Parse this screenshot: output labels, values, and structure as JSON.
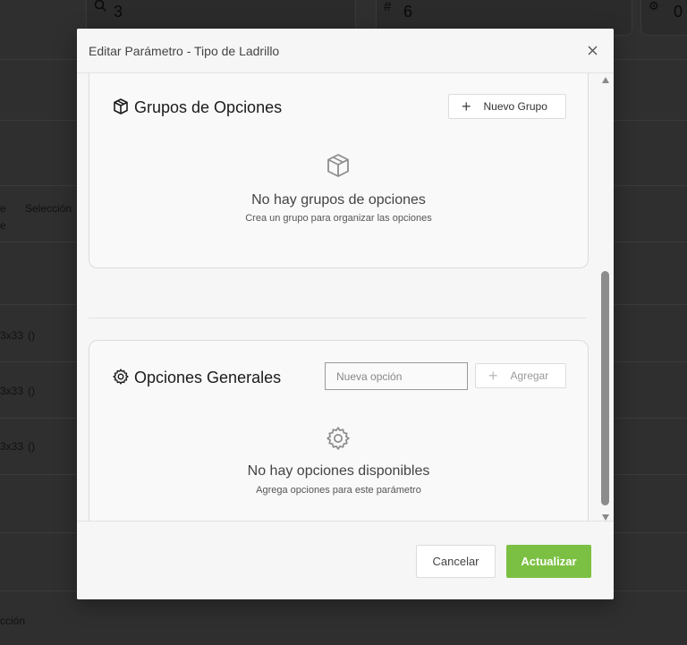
{
  "background": {
    "stat_cards": [
      {
        "icon": "search-icon",
        "value": "3"
      },
      {
        "icon": "hash-icon",
        "value": "6"
      },
      {
        "icon": "gear-icon",
        "value": "0"
      }
    ],
    "column_header_1": "e",
    "column_header_1b": "e",
    "column_header_2": "Selección",
    "rows": [
      "3x33",
      "3x33",
      "3x33"
    ],
    "row_suffix": "()",
    "bottom_text": "cción"
  },
  "modal": {
    "title": "Editar Parámetro - Tipo de Ladrillo",
    "close_icon": "close-icon",
    "groups": {
      "title": "Grupos de Opciones",
      "icon": "box-icon",
      "new_group_label": "Nuevo Grupo",
      "empty_title": "No hay grupos de opciones",
      "empty_subtitle": "Crea un grupo para organizar las opciones"
    },
    "general": {
      "title": "Opciones Generales",
      "icon": "gear-icon",
      "input_placeholder": "Nueva opción",
      "add_label": "Agregar",
      "empty_title": "No hay opciones disponibles",
      "empty_subtitle": "Agrega opciones para este parámetro"
    },
    "footer": {
      "cancel_label": "Cancelar",
      "update_label": "Actualizar"
    }
  },
  "colors": {
    "primary": "#7cc043",
    "backdrop": "#2f2f2f"
  }
}
